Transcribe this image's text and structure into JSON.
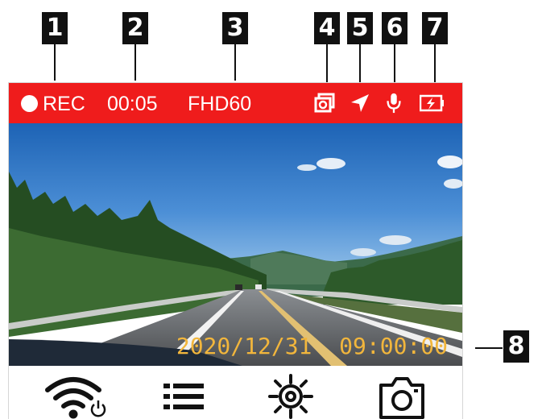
{
  "callouts": [
    "1",
    "2",
    "3",
    "4",
    "5",
    "6",
    "7",
    "8"
  ],
  "status_bar": {
    "rec_label": "REC",
    "elapsed": "00:05",
    "resolution": "FHD60",
    "background_color": "#ef1c1c",
    "icons": [
      "photo-stack-icon",
      "gps-arrow-icon",
      "microphone-icon",
      "battery-charging-icon"
    ]
  },
  "view": {
    "timestamp": "2020/12/31  09:00:00",
    "timestamp_color": "#f2b63c"
  },
  "toolbar": {
    "icons": [
      "wifi-power-icon",
      "menu-list-icon",
      "settings-gear-icon",
      "camera-icon"
    ]
  }
}
